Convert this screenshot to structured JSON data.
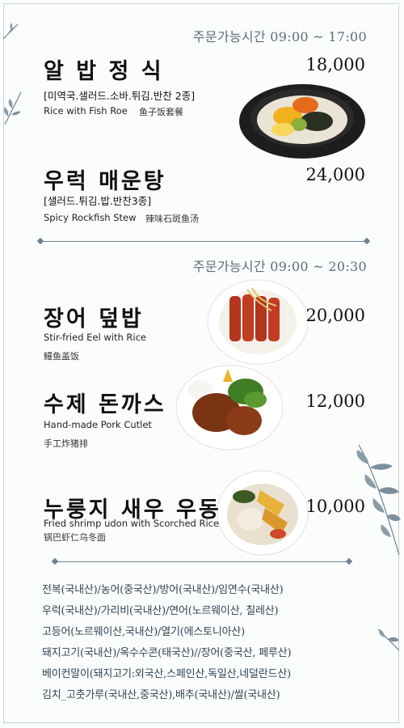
{
  "section1": {
    "hours": "주문가능시간 09:00 ~ 17:00",
    "items": [
      {
        "name": "알 밥 정 식",
        "price": "18,000",
        "detail": "[미역국.샐러드.소바.튀김.반찬 2종]",
        "english": "Rice with Fish Roe",
        "chinese": "鱼子饭套餐",
        "photo_icon": "fish-roe-rice-bowl-icon"
      },
      {
        "name": "우럭 매운탕",
        "price": "24,000",
        "detail": "[샐러드.튀김.밥.반찬3종]",
        "english": "Spicy Rockfish Stew",
        "chinese": "辣味石斑鱼汤"
      }
    ]
  },
  "section2": {
    "hours": "주문가능시간 09:00 ~ 20:30",
    "items": [
      {
        "name": "장어 덮밥",
        "price": "20,000",
        "english": "Stir-fried Eel with Rice",
        "chinese": "鳗鱼盖饭",
        "photo_icon": "eel-rice-bowl-icon"
      },
      {
        "name": "수제 돈까스",
        "price": "12,000",
        "english": "Hand-made Pork Cutlet",
        "chinese": "手工炸猪排",
        "photo_icon": "pork-cutlet-plate-icon"
      },
      {
        "name": "누룽지 새우 우동",
        "price": "10,000",
        "english": "Fried shrimp udon with Scorched Rice",
        "chinese": "锅巴虾仁乌冬面",
        "photo_icon": "shrimp-udon-bowl-icon"
      }
    ]
  },
  "origin": [
    "전복(국내산)/농어(중국산)/방어(국내산)/임연수(국내산)",
    "우럭(국내산)/가리비(국내산)/연어(노르웨이산, 칠레산)",
    "고등어(노르웨이산,국내산)/열기(에스토니아산)",
    "돼지고기(국내산)/옥수수콘(태국산)//장어(중국산, 페루산)",
    "베이컨말이(돼지고기:외국산,스페인산,독일산,네덜란드산)",
    "김치_고춧가루(국내산,중국산),배추(국내산)/쌀(국내산)"
  ],
  "colors": {
    "accent": "#5a6e7c",
    "leaf": "#6f8290",
    "text": "#111111"
  },
  "decor_icon": "leaf-branch-icon"
}
